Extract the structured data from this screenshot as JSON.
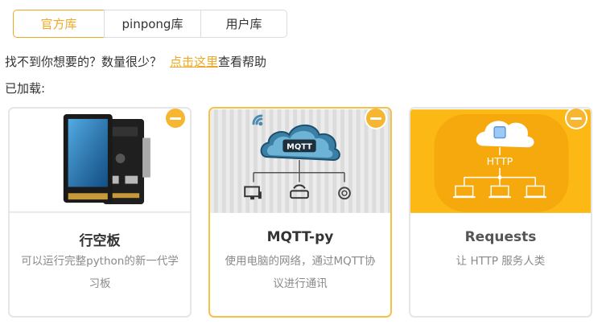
{
  "tabs": [
    {
      "label": "官方库",
      "active": true
    },
    {
      "label": "pinpong库",
      "active": false
    },
    {
      "label": "用户库",
      "active": false
    }
  ],
  "hint": {
    "text": "找不到你想要的？数量很少？",
    "link_text": "点击这里",
    "after_link": "查看帮助"
  },
  "loaded_label": "已加载:",
  "cards": [
    {
      "title": "行空板",
      "desc": "可以运行完整python的新一代学习板"
    },
    {
      "title": "MQTT-py",
      "desc": "使用电脑的网络，通过MQTT协议进行通讯",
      "image_badge": "MQTT"
    },
    {
      "title": "Requests",
      "desc": "让 HTTP 服务人类",
      "image_badge": "HTTP"
    }
  ],
  "colors": {
    "accent": "#f0a821",
    "remove": "#f6b632",
    "requests_bg": "#fcb814"
  }
}
